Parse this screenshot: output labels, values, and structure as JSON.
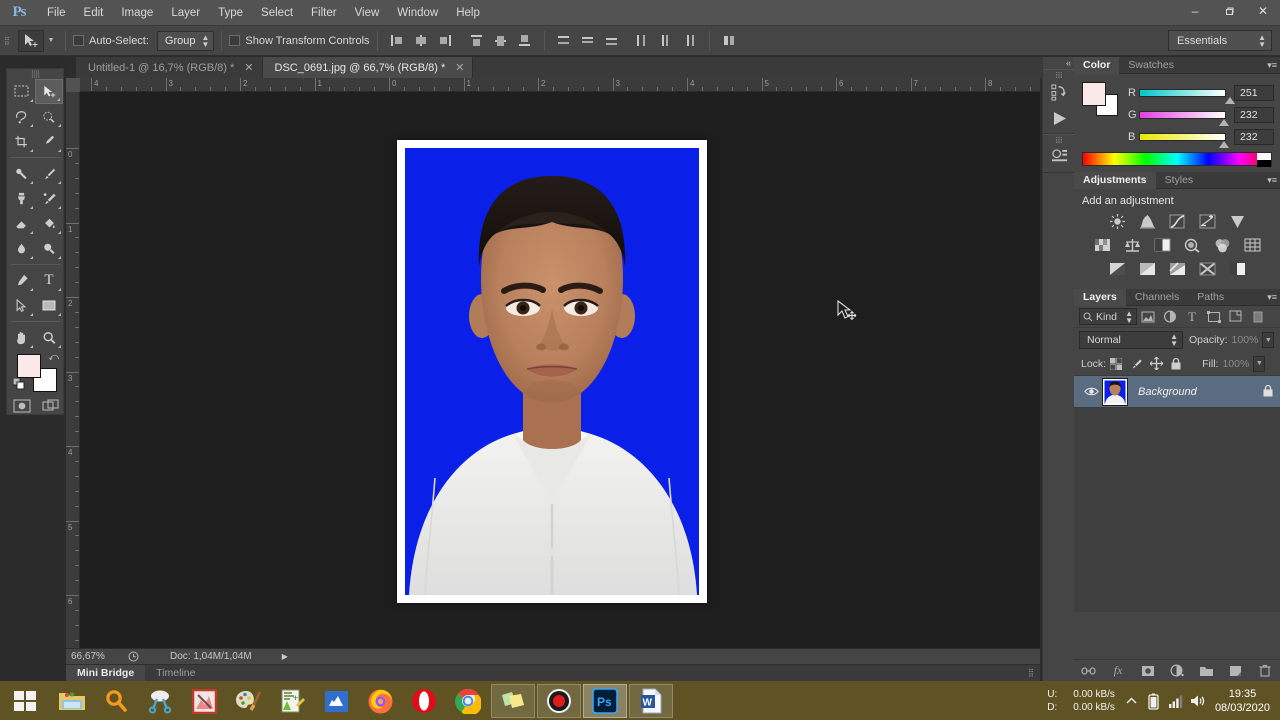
{
  "app": {
    "name": "Ps",
    "logo_text": "Ps"
  },
  "menubar": {
    "items": [
      "File",
      "Edit",
      "Image",
      "Layer",
      "Type",
      "Select",
      "Filter",
      "View",
      "Window",
      "Help"
    ]
  },
  "window_controls": {
    "minimize": "–",
    "restore": "❐",
    "close": "✕"
  },
  "options_bar": {
    "tool_icon": "move-tool-icon",
    "auto_select_label": "Auto-Select:",
    "auto_select_checked": false,
    "group_select_value": "Group",
    "show_transform_label": "Show Transform Controls",
    "show_transform_checked": false,
    "workspace_value": "Essentials"
  },
  "doc_tabs": [
    {
      "label": "Untitled-1 @ 16,7% (RGB/8) *",
      "close": "✕",
      "active": false
    },
    {
      "label": "DSC_0691.jpg @ 66,7% (RGB/8) *",
      "close": "✕",
      "active": true
    }
  ],
  "toolbar": {
    "tools": [
      {
        "name": "rectangular-marquee-tool",
        "glyph": "⬚",
        "selected": false
      },
      {
        "name": "move-tool",
        "glyph": "➤",
        "selected": true
      },
      {
        "name": "lasso-tool",
        "glyph": "❦",
        "selected": false
      },
      {
        "name": "quick-selection-tool",
        "glyph": "❁",
        "selected": false
      },
      {
        "name": "crop-tool",
        "glyph": "⌗",
        "selected": false
      },
      {
        "name": "eyedropper-tool",
        "glyph": "✒",
        "selected": false
      },
      {
        "name": "spot-healing-brush-tool",
        "glyph": "⊕",
        "selected": false
      },
      {
        "name": "brush-tool",
        "glyph": "✎",
        "selected": false
      },
      {
        "name": "clone-stamp-tool",
        "glyph": "⚑",
        "selected": false
      },
      {
        "name": "history-brush-tool",
        "glyph": "✐",
        "selected": false
      },
      {
        "name": "eraser-tool",
        "glyph": "▱",
        "selected": false
      },
      {
        "name": "gradient-tool",
        "glyph": "◩",
        "selected": false
      },
      {
        "name": "blur-tool",
        "glyph": "●",
        "selected": false
      },
      {
        "name": "dodge-tool",
        "glyph": "⚲",
        "selected": false
      },
      {
        "name": "pen-tool",
        "glyph": "✒",
        "selected": false
      },
      {
        "name": "horizontal-type-tool",
        "glyph": "T",
        "selected": false
      },
      {
        "name": "path-selection-tool",
        "glyph": "➤",
        "selected": false
      },
      {
        "name": "rectangle-tool",
        "glyph": "■",
        "selected": false
      },
      {
        "name": "hand-tool",
        "glyph": "✋",
        "selected": false
      },
      {
        "name": "zoom-tool",
        "glyph": "⚲",
        "selected": false
      }
    ],
    "foreground_color": "#fbe8e8",
    "background_color": "#ffffff",
    "quick_mask_name": "edit-in-quick-mask-mode",
    "screen_mode_name": "change-screen-mode"
  },
  "rulers": {
    "unit": "cm",
    "horizontal_labels": [
      "4",
      "3",
      "2",
      "1",
      "0",
      "1",
      "2",
      "3",
      "4",
      "5",
      "6",
      "7",
      "8"
    ],
    "vertical_labels": [
      "0",
      "1",
      "2",
      "3",
      "4",
      "5",
      "6"
    ]
  },
  "canvas": {
    "document_name": "DSC_0691.jpg",
    "background_color": "#0a20e8",
    "border_color": "#ffffff"
  },
  "status_bar": {
    "zoom": "66,67%",
    "doc_info": "Doc: 1,04M/1,04M",
    "arrow": "▶"
  },
  "bottom_tabs": [
    {
      "label": "Mini Bridge",
      "active": true
    },
    {
      "label": "Timeline",
      "active": false
    }
  ],
  "dock_strip": {
    "collapse": "«",
    "buttons": [
      {
        "name": "history-panel-icon",
        "glyph": "↺"
      },
      {
        "name": "actions-panel-icon",
        "glyph": "▶"
      },
      {
        "name": "properties-panel-icon",
        "glyph": "☰"
      }
    ]
  },
  "color_panel": {
    "tabs": [
      {
        "label": "Color",
        "active": true
      },
      {
        "label": "Swatches",
        "active": false
      }
    ],
    "menu": "▾≡",
    "channels": [
      {
        "label": "R",
        "value": "251",
        "pct": 98
      },
      {
        "label": "G",
        "value": "232",
        "pct": 91
      },
      {
        "label": "B",
        "value": "232",
        "pct": 91
      }
    ],
    "foreground": "#fbe8e8",
    "background": "#ffffff"
  },
  "adjustments_panel": {
    "tabs": [
      {
        "label": "Adjustments",
        "active": true
      },
      {
        "label": "Styles",
        "active": false
      }
    ],
    "menu": "▾≡",
    "title": "Add an adjustment",
    "row1": [
      {
        "name": "brightness-contrast-icon",
        "glyph": "☀"
      },
      {
        "name": "levels-icon",
        "glyph": "░"
      },
      {
        "name": "curves-icon",
        "glyph": "↗"
      },
      {
        "name": "exposure-icon",
        "glyph": "±"
      },
      {
        "name": "vibrance-icon",
        "glyph": "▽"
      }
    ],
    "row2": [
      {
        "name": "hue-saturation-icon",
        "glyph": "▤"
      },
      {
        "name": "color-balance-icon",
        "glyph": "⚖"
      },
      {
        "name": "black-white-icon",
        "glyph": "◧"
      },
      {
        "name": "photo-filter-icon",
        "glyph": "◔"
      },
      {
        "name": "channel-mixer-icon",
        "glyph": "⬤"
      },
      {
        "name": "color-lookup-icon",
        "glyph": "⊞"
      }
    ],
    "row3": [
      {
        "name": "invert-icon",
        "glyph": "◑"
      },
      {
        "name": "posterize-icon",
        "glyph": "◩"
      },
      {
        "name": "threshold-icon",
        "glyph": "◨"
      },
      {
        "name": "gradient-map-icon",
        "glyph": "⨉"
      },
      {
        "name": "selective-color-icon",
        "glyph": "■"
      }
    ]
  },
  "layers_panel": {
    "tabs": [
      {
        "label": "Layers",
        "active": true
      },
      {
        "label": "Channels",
        "active": false
      },
      {
        "label": "Paths",
        "active": false
      }
    ],
    "menu": "▾≡",
    "filter": {
      "search_icon": "search-icon",
      "kind_value": "Kind",
      "type_filters": [
        {
          "name": "filter-pixel-layers-icon",
          "glyph": "⛰"
        },
        {
          "name": "filter-adjustment-layers-icon",
          "glyph": "◐"
        },
        {
          "name": "filter-type-layers-icon",
          "glyph": "T"
        },
        {
          "name": "filter-shape-layers-icon",
          "glyph": "⬚"
        },
        {
          "name": "filter-smart-objects-icon",
          "glyph": "⧉"
        }
      ],
      "toggle_name": "filter-toggle-switch"
    },
    "blend_mode": "Normal",
    "opacity_label": "Opacity:",
    "opacity_value": "100%",
    "lock_label": "Lock:",
    "lock_icons": [
      {
        "name": "lock-transparent-pixels-icon",
        "glyph": "▒"
      },
      {
        "name": "lock-image-pixels-icon",
        "glyph": "✎"
      },
      {
        "name": "lock-position-icon",
        "glyph": "✚"
      },
      {
        "name": "lock-all-icon",
        "glyph": "ὑ2"
      }
    ],
    "fill_label": "Fill:",
    "fill_value": "100%",
    "layers": [
      {
        "name": "Background",
        "visible": true,
        "locked": true,
        "eye_icon": "eye-icon",
        "lock_icon": "lock-icon"
      }
    ],
    "bottom_buttons": [
      {
        "name": "link-layers-icon",
        "glyph": "⚭"
      },
      {
        "name": "layer-style-fx-icon",
        "glyph": "fx"
      },
      {
        "name": "add-layer-mask-icon",
        "glyph": "▣"
      },
      {
        "name": "new-fill-adjustment-icon",
        "glyph": "◑"
      },
      {
        "name": "new-group-icon",
        "glyph": "▰"
      },
      {
        "name": "new-layer-icon",
        "glyph": "⧉"
      },
      {
        "name": "delete-layer-icon",
        "glyph": "Ὕ1"
      }
    ]
  },
  "taskbar": {
    "start_name": "windows-start-button",
    "items": [
      {
        "name": "file-explorer-icon",
        "state": "pinned"
      },
      {
        "name": "search-icon",
        "state": "pinned"
      },
      {
        "name": "snipping-tool-icon",
        "state": "pinned"
      },
      {
        "name": "image-editor-icon",
        "state": "pinned"
      },
      {
        "name": "paint-icon",
        "state": "pinned"
      },
      {
        "name": "notepad-plus-icon",
        "state": "pinned"
      },
      {
        "name": "scanner-icon",
        "state": "pinned"
      },
      {
        "name": "firefox-icon",
        "state": "pinned"
      },
      {
        "name": "opera-icon",
        "state": "pinned"
      },
      {
        "name": "chrome-icon",
        "state": "pinned"
      },
      {
        "name": "folders-app-icon",
        "state": "running"
      },
      {
        "name": "screen-recorder-icon",
        "state": "running"
      },
      {
        "name": "photoshop-icon",
        "state": "active"
      },
      {
        "name": "word-icon",
        "state": "running"
      }
    ],
    "tray": {
      "upload_label": "U:",
      "upload_value": "0.00 kB/s",
      "download_label": "D:",
      "download_value": "0.00 kB/s",
      "show_hidden_icon": "chevron-up-icon",
      "battery_icon": "battery-icon",
      "network_icon": "network-icon",
      "volume_icon": "volume-icon",
      "time": "19:35",
      "date": "08/03/2020"
    }
  }
}
